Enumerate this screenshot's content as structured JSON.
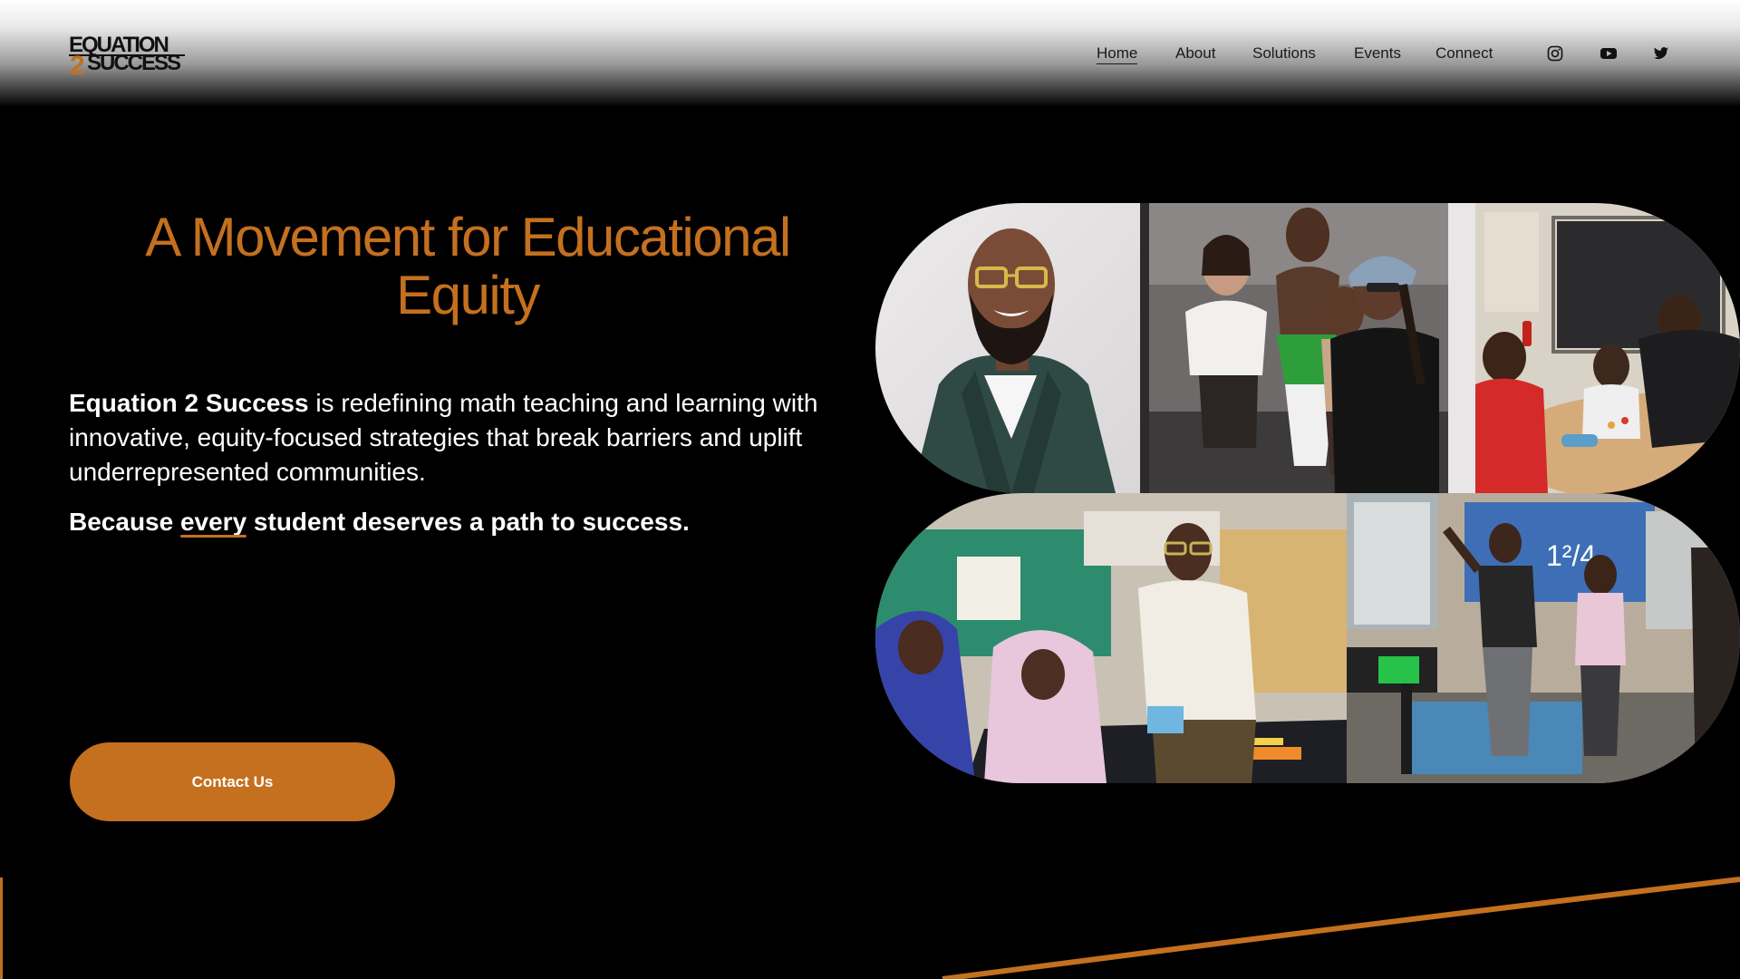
{
  "brand": {
    "logo_line1": "EQUATION",
    "logo_two": "2",
    "logo_line2": "SUCCESS",
    "accent_color": "#c4701f"
  },
  "nav": {
    "items": [
      {
        "label": "Home",
        "active": true
      },
      {
        "label": "About"
      },
      {
        "label": "Solutions"
      },
      {
        "label": "Events"
      },
      {
        "label": "Connect"
      }
    ]
  },
  "social": [
    {
      "icon": "instagram-icon"
    },
    {
      "icon": "youtube-icon"
    },
    {
      "icon": "twitter-icon"
    }
  ],
  "hero": {
    "title": "A Movement for Educational Equity",
    "desc_brand": "Equation 2 Success",
    "desc_rest": " is redefining math teaching and learning with innovative, equity-focused strategies that break barriers and uplift underrepresented communities.",
    "tag_before": "Because ",
    "tag_em": "every",
    "tag_after": " student deserves a path to success.",
    "cta": "Contact Us"
  },
  "collage": {
    "photos": [
      {
        "name": "photo-portrait-man-green-blazer"
      },
      {
        "name": "photo-group-selfie"
      },
      {
        "name": "photo-kids-at-table"
      },
      {
        "name": "photo-students-with-teacher"
      },
      {
        "name": "photo-teacher-presenting-fraction"
      }
    ],
    "fraction_text": "1²/4"
  }
}
